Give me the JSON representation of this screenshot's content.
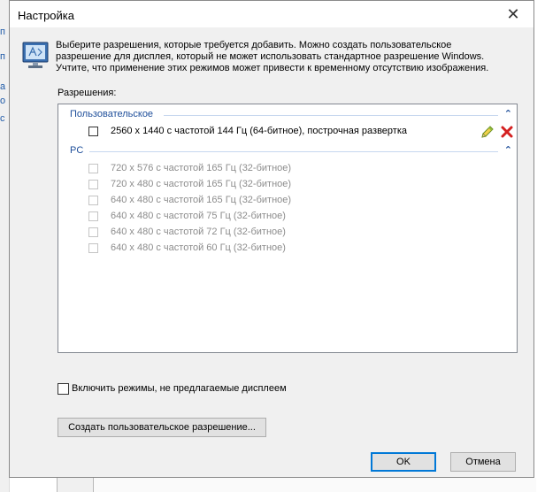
{
  "window": {
    "title": "Настройка",
    "close_glyph": "✕",
    "header_icon": "monitor-icon"
  },
  "intro": {
    "line1": "Выберите разрешения, которые требуется добавить. Можно создать пользовательское",
    "line2": "разрешение для дисплея, который не может использовать стандартное разрешение Windows.",
    "line3": "Учтите, что применение этих режимов может привести к временному отсутствию изображения."
  },
  "resolutions_label": "Разрешения:",
  "groups": {
    "custom": {
      "label": "Пользовательское",
      "items": [
        {
          "text": "2560 x 1440 с частотой 144 Гц (64-битное), построчная развертка",
          "checked": false,
          "enabled": true
        }
      ]
    },
    "pc": {
      "label": "PC",
      "items": [
        {
          "text": "720 x 576 с частотой 165 Гц (32-битное)",
          "checked": false,
          "enabled": false
        },
        {
          "text": "720 x 480 с частотой 165 Гц (32-битное)",
          "checked": false,
          "enabled": false
        },
        {
          "text": "640 x 480 с частотой 165 Гц (32-битное)",
          "checked": false,
          "enabled": false
        },
        {
          "text": "640 x 480 с частотой 75 Гц (32-битное)",
          "checked": false,
          "enabled": false
        },
        {
          "text": "640 x 480 с частотой 72 Гц (32-битное)",
          "checked": false,
          "enabled": false
        },
        {
          "text": "640 x 480 с частотой 60 Гц (32-битное)",
          "checked": false,
          "enabled": false
        }
      ]
    }
  },
  "chevron_glyph": "⌃",
  "include_modes": {
    "label": "Включить режимы, не предлагаемые дисплеем",
    "checked": false
  },
  "buttons": {
    "create": "Создать пользовательское разрешение...",
    "ok": "OK",
    "cancel": "Отмена"
  },
  "colors": {
    "group_header": "#1e4e9a",
    "delete_red": "#d42020",
    "ok_border": "#0078d7"
  }
}
